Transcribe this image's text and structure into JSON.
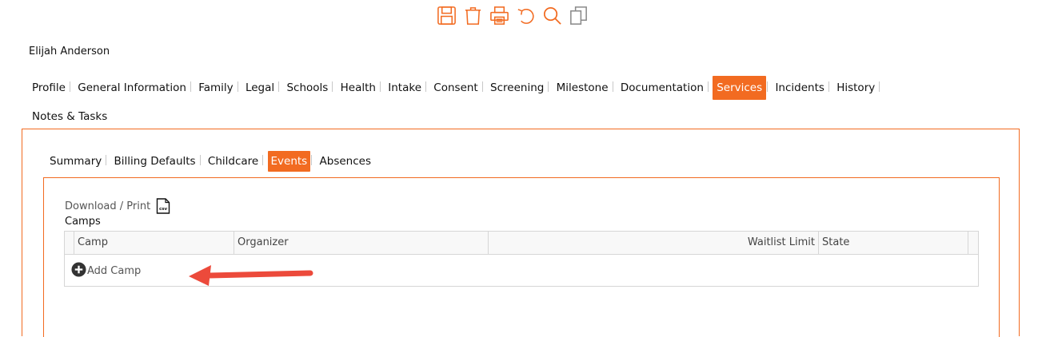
{
  "colors": {
    "accent": "#f26b21",
    "arrow": "#ec4a3b"
  },
  "toolbar": {
    "icons": [
      "save-icon",
      "trash-icon",
      "print-icon",
      "undo-icon",
      "search-icon",
      "copy-icon"
    ]
  },
  "student": {
    "name": "Elijah Anderson"
  },
  "main_tabs": [
    "Profile",
    "General Information",
    "Family",
    "Legal",
    "Schools",
    "Health",
    "Intake",
    "Consent",
    "Screening",
    "Milestone",
    "Documentation",
    "Services",
    "Incidents",
    "History",
    "Notes & Tasks"
  ],
  "main_tabs_active": "Services",
  "sub_tabs": [
    "Summary",
    "Billing Defaults",
    "Childcare",
    "Events",
    "Absences"
  ],
  "sub_tabs_active": "Events",
  "download": {
    "label": "Download / Print",
    "icon": "csv-file-icon"
  },
  "camps": {
    "title": "Camps",
    "columns": [
      "Camp",
      "Organizer",
      "Waitlist Limit",
      "State"
    ],
    "add_label": "Add Camp",
    "add_icon": "plus-circle-icon"
  }
}
